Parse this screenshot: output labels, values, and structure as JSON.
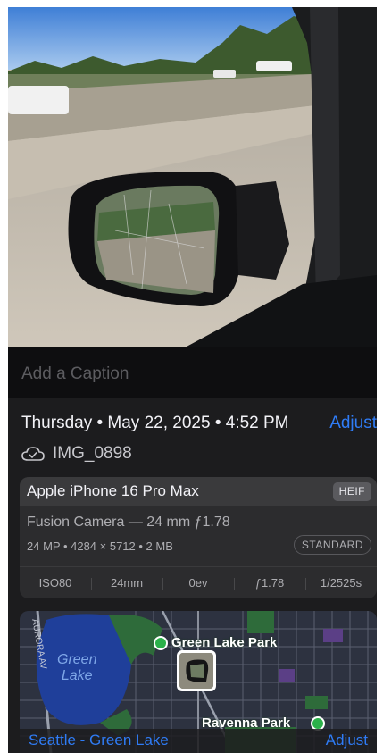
{
  "caption": {
    "placeholder": "Add a Caption"
  },
  "info": {
    "date_line": "Thursday • May 22, 2025 • 4:52 PM",
    "adjust_label": "Adjust",
    "file_icon": "cloud-check-icon",
    "file_name": "IMG_0898"
  },
  "device": {
    "name": "Apple iPhone 16 Pro Max",
    "format": "HEIF",
    "camera": "Fusion Camera — 24 mm ƒ1.78",
    "specs": "24 MP • 4284 × 5712 • 2 MB",
    "style": "STANDARD",
    "exif": [
      "ISO80",
      "24mm",
      "0ev",
      "ƒ1.78",
      "1/2525s"
    ]
  },
  "map": {
    "labels": {
      "park_north": "Green Lake Park",
      "park_south": "Ravenna Park",
      "lake": "Green\nLake",
      "street": "AURORA AV"
    },
    "location_label": "Seattle - Green Lake",
    "adjust_label": "Adjust"
  },
  "colors": {
    "accent": "#2f7cf6",
    "background": "#1c1c1e",
    "park_pin": "#2bb14a"
  }
}
